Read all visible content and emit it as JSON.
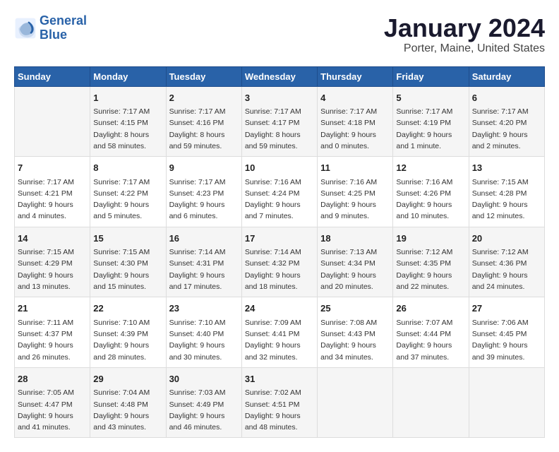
{
  "logo": {
    "line1": "General",
    "line2": "Blue"
  },
  "title": "January 2024",
  "subtitle": "Porter, Maine, United States",
  "days_of_week": [
    "Sunday",
    "Monday",
    "Tuesday",
    "Wednesday",
    "Thursday",
    "Friday",
    "Saturday"
  ],
  "weeks": [
    [
      {
        "day": "",
        "sunrise": "",
        "sunset": "",
        "daylight": ""
      },
      {
        "day": "1",
        "sunrise": "Sunrise: 7:17 AM",
        "sunset": "Sunset: 4:15 PM",
        "daylight": "Daylight: 8 hours and 58 minutes."
      },
      {
        "day": "2",
        "sunrise": "Sunrise: 7:17 AM",
        "sunset": "Sunset: 4:16 PM",
        "daylight": "Daylight: 8 hours and 59 minutes."
      },
      {
        "day": "3",
        "sunrise": "Sunrise: 7:17 AM",
        "sunset": "Sunset: 4:17 PM",
        "daylight": "Daylight: 8 hours and 59 minutes."
      },
      {
        "day": "4",
        "sunrise": "Sunrise: 7:17 AM",
        "sunset": "Sunset: 4:18 PM",
        "daylight": "Daylight: 9 hours and 0 minutes."
      },
      {
        "day": "5",
        "sunrise": "Sunrise: 7:17 AM",
        "sunset": "Sunset: 4:19 PM",
        "daylight": "Daylight: 9 hours and 1 minute."
      },
      {
        "day": "6",
        "sunrise": "Sunrise: 7:17 AM",
        "sunset": "Sunset: 4:20 PM",
        "daylight": "Daylight: 9 hours and 2 minutes."
      }
    ],
    [
      {
        "day": "7",
        "sunrise": "Sunrise: 7:17 AM",
        "sunset": "Sunset: 4:21 PM",
        "daylight": "Daylight: 9 hours and 4 minutes."
      },
      {
        "day": "8",
        "sunrise": "Sunrise: 7:17 AM",
        "sunset": "Sunset: 4:22 PM",
        "daylight": "Daylight: 9 hours and 5 minutes."
      },
      {
        "day": "9",
        "sunrise": "Sunrise: 7:17 AM",
        "sunset": "Sunset: 4:23 PM",
        "daylight": "Daylight: 9 hours and 6 minutes."
      },
      {
        "day": "10",
        "sunrise": "Sunrise: 7:16 AM",
        "sunset": "Sunset: 4:24 PM",
        "daylight": "Daylight: 9 hours and 7 minutes."
      },
      {
        "day": "11",
        "sunrise": "Sunrise: 7:16 AM",
        "sunset": "Sunset: 4:25 PM",
        "daylight": "Daylight: 9 hours and 9 minutes."
      },
      {
        "day": "12",
        "sunrise": "Sunrise: 7:16 AM",
        "sunset": "Sunset: 4:26 PM",
        "daylight": "Daylight: 9 hours and 10 minutes."
      },
      {
        "day": "13",
        "sunrise": "Sunrise: 7:15 AM",
        "sunset": "Sunset: 4:28 PM",
        "daylight": "Daylight: 9 hours and 12 minutes."
      }
    ],
    [
      {
        "day": "14",
        "sunrise": "Sunrise: 7:15 AM",
        "sunset": "Sunset: 4:29 PM",
        "daylight": "Daylight: 9 hours and 13 minutes."
      },
      {
        "day": "15",
        "sunrise": "Sunrise: 7:15 AM",
        "sunset": "Sunset: 4:30 PM",
        "daylight": "Daylight: 9 hours and 15 minutes."
      },
      {
        "day": "16",
        "sunrise": "Sunrise: 7:14 AM",
        "sunset": "Sunset: 4:31 PM",
        "daylight": "Daylight: 9 hours and 17 minutes."
      },
      {
        "day": "17",
        "sunrise": "Sunrise: 7:14 AM",
        "sunset": "Sunset: 4:32 PM",
        "daylight": "Daylight: 9 hours and 18 minutes."
      },
      {
        "day": "18",
        "sunrise": "Sunrise: 7:13 AM",
        "sunset": "Sunset: 4:34 PM",
        "daylight": "Daylight: 9 hours and 20 minutes."
      },
      {
        "day": "19",
        "sunrise": "Sunrise: 7:12 AM",
        "sunset": "Sunset: 4:35 PM",
        "daylight": "Daylight: 9 hours and 22 minutes."
      },
      {
        "day": "20",
        "sunrise": "Sunrise: 7:12 AM",
        "sunset": "Sunset: 4:36 PM",
        "daylight": "Daylight: 9 hours and 24 minutes."
      }
    ],
    [
      {
        "day": "21",
        "sunrise": "Sunrise: 7:11 AM",
        "sunset": "Sunset: 4:37 PM",
        "daylight": "Daylight: 9 hours and 26 minutes."
      },
      {
        "day": "22",
        "sunrise": "Sunrise: 7:10 AM",
        "sunset": "Sunset: 4:39 PM",
        "daylight": "Daylight: 9 hours and 28 minutes."
      },
      {
        "day": "23",
        "sunrise": "Sunrise: 7:10 AM",
        "sunset": "Sunset: 4:40 PM",
        "daylight": "Daylight: 9 hours and 30 minutes."
      },
      {
        "day": "24",
        "sunrise": "Sunrise: 7:09 AM",
        "sunset": "Sunset: 4:41 PM",
        "daylight": "Daylight: 9 hours and 32 minutes."
      },
      {
        "day": "25",
        "sunrise": "Sunrise: 7:08 AM",
        "sunset": "Sunset: 4:43 PM",
        "daylight": "Daylight: 9 hours and 34 minutes."
      },
      {
        "day": "26",
        "sunrise": "Sunrise: 7:07 AM",
        "sunset": "Sunset: 4:44 PM",
        "daylight": "Daylight: 9 hours and 37 minutes."
      },
      {
        "day": "27",
        "sunrise": "Sunrise: 7:06 AM",
        "sunset": "Sunset: 4:45 PM",
        "daylight": "Daylight: 9 hours and 39 minutes."
      }
    ],
    [
      {
        "day": "28",
        "sunrise": "Sunrise: 7:05 AM",
        "sunset": "Sunset: 4:47 PM",
        "daylight": "Daylight: 9 hours and 41 minutes."
      },
      {
        "day": "29",
        "sunrise": "Sunrise: 7:04 AM",
        "sunset": "Sunset: 4:48 PM",
        "daylight": "Daylight: 9 hours and 43 minutes."
      },
      {
        "day": "30",
        "sunrise": "Sunrise: 7:03 AM",
        "sunset": "Sunset: 4:49 PM",
        "daylight": "Daylight: 9 hours and 46 minutes."
      },
      {
        "day": "31",
        "sunrise": "Sunrise: 7:02 AM",
        "sunset": "Sunset: 4:51 PM",
        "daylight": "Daylight: 9 hours and 48 minutes."
      },
      {
        "day": "",
        "sunrise": "",
        "sunset": "",
        "daylight": ""
      },
      {
        "day": "",
        "sunrise": "",
        "sunset": "",
        "daylight": ""
      },
      {
        "day": "",
        "sunrise": "",
        "sunset": "",
        "daylight": ""
      }
    ]
  ]
}
